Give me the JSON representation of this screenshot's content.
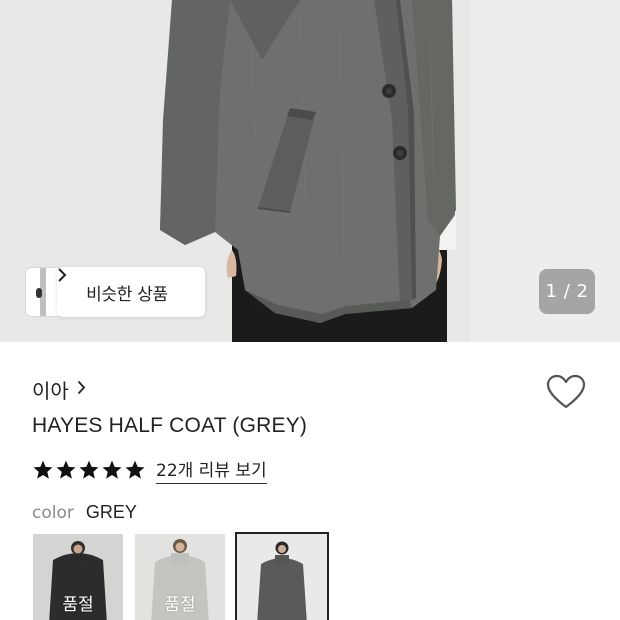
{
  "gallery": {
    "similar_label": "비슷한 상품",
    "counter": "1 / 2"
  },
  "product": {
    "brand": "이아",
    "title": "HAYES HALF COAT (GREY)",
    "rating_stars": 5,
    "reviews_label": "22개 리뷰 보기"
  },
  "color": {
    "label": "color",
    "value": "GREY"
  },
  "swatches": [
    {
      "badge": "품절",
      "tone": "#3a3a3a"
    },
    {
      "badge": "품절",
      "tone": "#cfcfcb"
    },
    {
      "badge": "",
      "tone": "#5b5b5b"
    }
  ],
  "icons": {
    "heart": "heart-icon",
    "chevron": "chevron-right-icon",
    "star": "star-icon"
  }
}
